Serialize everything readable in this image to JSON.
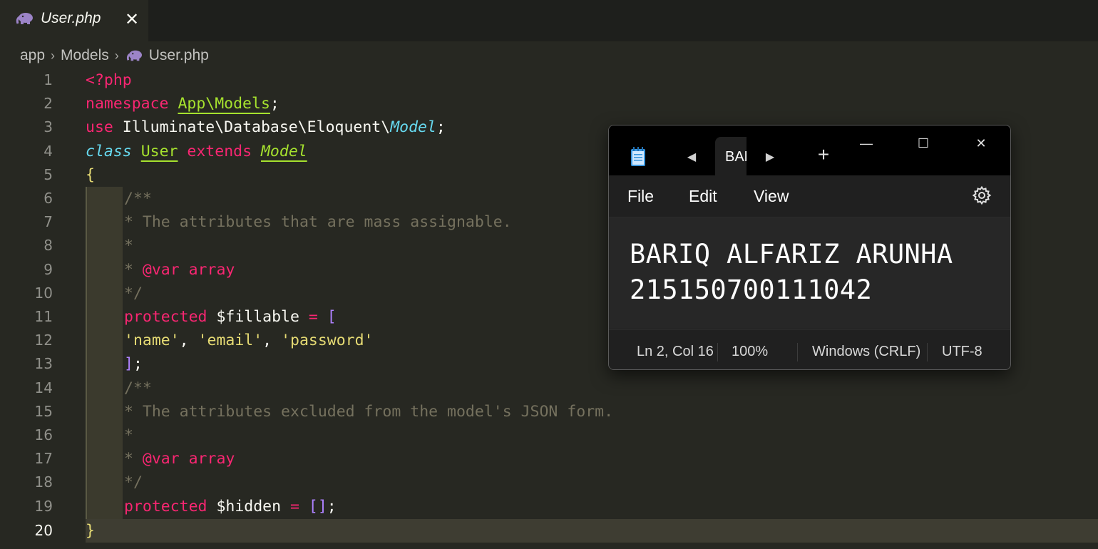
{
  "editor_tab": {
    "label": "User.php",
    "close_glyph": "✕",
    "icon": "php-elephant-icon"
  },
  "breadcrumb": {
    "items": [
      "app",
      "Models",
      "User.php"
    ],
    "separator": "›"
  },
  "gutter": {
    "line_numbers": [
      "1",
      "2",
      "3",
      "4",
      "5",
      "6",
      "7",
      "8",
      "9",
      "10",
      "11",
      "12",
      "13",
      "14",
      "15",
      "16",
      "17",
      "18",
      "19",
      "20"
    ],
    "current_line": "20"
  },
  "code": {
    "l1": {
      "open_tag": "<?php"
    },
    "l2": {
      "kw": "namespace",
      "ns": "App\\Models",
      "semi": ";"
    },
    "l3": {
      "kw": "use",
      "path": "Illuminate\\Database\\Eloquent\\",
      "cls": "Model",
      "semi": ";"
    },
    "l4": {
      "kw_class": "class",
      "name": "User",
      "kw_extends": "extends",
      "parent": "Model"
    },
    "l5": {
      "brace": "{"
    },
    "l6": {
      "text": "/**"
    },
    "l7": {
      "text": "* The attributes that are mass assignable."
    },
    "l8": {
      "text": "*"
    },
    "l9": {
      "star": "* ",
      "tag": "@var",
      "type": " array"
    },
    "l10": {
      "text": "*/"
    },
    "l11": {
      "kw": "protected",
      "var": " $fillable ",
      "op": "=",
      "bracket": " ["
    },
    "l12": {
      "s1": "'name'",
      "c1": ", ",
      "s2": "'email'",
      "c2": ", ",
      "s3": "'password'"
    },
    "l13": {
      "bracket": "]",
      "semi": ";"
    },
    "l14": {
      "text": "/**"
    },
    "l15": {
      "text": "* The attributes excluded from the model's JSON form."
    },
    "l16": {
      "text": "*"
    },
    "l17": {
      "star": "* ",
      "tag": "@var",
      "type": " array"
    },
    "l18": {
      "text": "*/"
    },
    "l19": {
      "kw": "protected",
      "var": " $hidden ",
      "op": "=",
      "bracket": " []",
      "semi": ";"
    },
    "l20": {
      "brace": "}"
    }
  },
  "notepad": {
    "tab_label": "BARIQ ALFARIZ ARUNHA",
    "nav_prev": "◀",
    "nav_next": "▶",
    "new_tab": "+",
    "window_buttons": {
      "minimize": "—",
      "maximize": "☐",
      "close": "✕"
    },
    "menu": [
      "File",
      "Edit",
      "View"
    ],
    "content_lines": [
      "BARIQ ALFARIZ ARUNHA",
      "215150700111042"
    ],
    "status": {
      "position": "Ln 2, Col 16",
      "zoom": "100%",
      "line_ending": "Windows (CRLF)",
      "encoding": "UTF-8"
    }
  },
  "colors": {
    "editor_bg": "#272822",
    "keyword": "#f92672",
    "entity": "#a6e22e",
    "comment": "#75715e",
    "string": "#e6db74",
    "storage_type": "#66d9ef",
    "notepad_bg": "#202020"
  }
}
